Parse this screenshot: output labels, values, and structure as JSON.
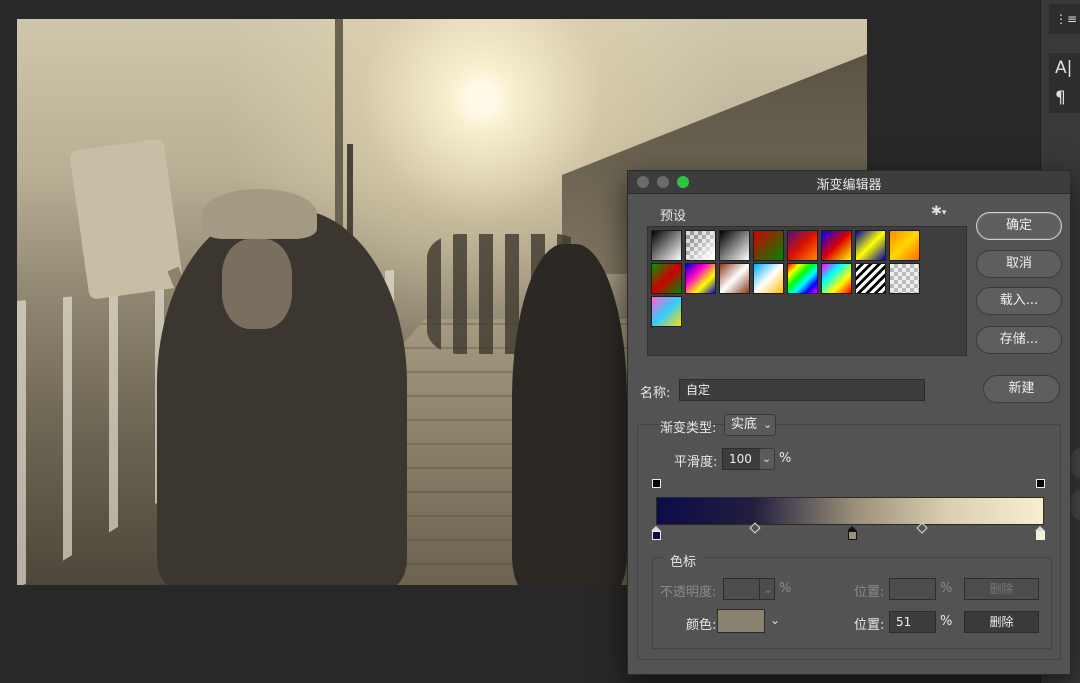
{
  "dialog": {
    "title": "渐变编辑器",
    "presets_label": "预设",
    "gear_glyph": "✱",
    "presets": [
      [
        "#000",
        "#fff"
      ],
      [
        "checker"
      ],
      [
        "#000",
        "#fff"
      ],
      [
        "#c00",
        "#080"
      ],
      [
        "#4b1480",
        "#d10",
        "#ff8a00"
      ],
      [
        "#00f",
        "#d00",
        "#ff0"
      ],
      [
        "#00a",
        "#ff0",
        "#00a"
      ],
      [
        "#ff8c00",
        "#ffd700",
        "#ff6a00"
      ],
      [
        "#090",
        "#c00",
        "#080"
      ],
      [
        "#00c",
        "#f0c",
        "#ff0",
        "#00c"
      ],
      [
        "#8a3a1e",
        "#fff",
        "#8a3a1e"
      ],
      [
        "#0af",
        "#fff",
        "#fb0"
      ],
      [
        "#f00",
        "#ff0",
        "#0f0",
        "#0ff",
        "#00f",
        "#f0f"
      ],
      [
        "#f0f",
        "#0ff",
        "#ff0",
        "#f00"
      ],
      [
        "stripes"
      ],
      [
        "checker2"
      ],
      [
        "#f6c",
        "#3cf",
        "#fd0"
      ]
    ],
    "buttons": {
      "ok": "确定",
      "cancel": "取消",
      "load": "载入...",
      "save": "存储...",
      "new": "新建"
    },
    "name_label": "名称:",
    "name_value": "自定",
    "type_label": "渐变类型:",
    "type_value": "实底",
    "smooth_label": "平滑度:",
    "smooth_value": "100",
    "smooth_unit": "%",
    "gradient_colors": {
      "start": "#0c0c4a",
      "middle": "#9a8f78",
      "end": "#f7efce"
    },
    "stops_group_label": "色标",
    "opacity_label": "不透明度:",
    "opacity_unit": "%",
    "opacity_location_label": "位置:",
    "opacity_location_unit": "%",
    "opacity_delete": "删除",
    "color_label": "颜色:",
    "color_value": "#8b8370",
    "color_location_label": "位置:",
    "color_location_value": "51",
    "color_location_unit": "%",
    "color_delete": "删除"
  },
  "right_panel": {
    "item1": "⋮≡",
    "item2": "A|",
    "item3": "¶"
  }
}
